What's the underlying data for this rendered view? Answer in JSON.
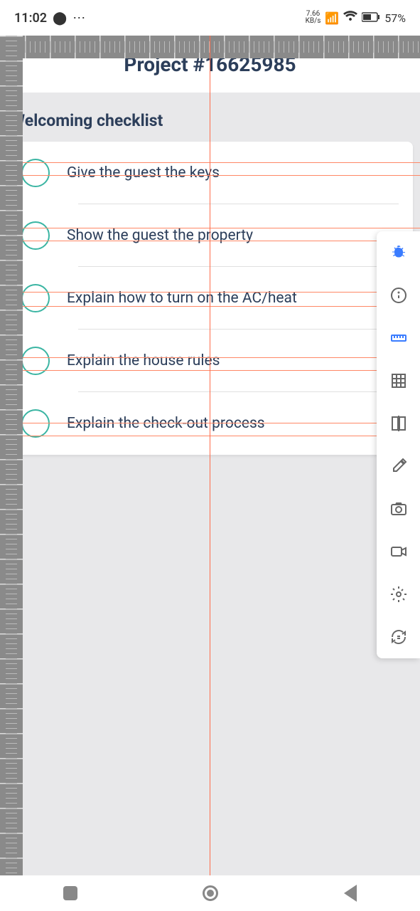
{
  "status": {
    "time": "11:02",
    "kbs_top": "7.66",
    "kbs_bottom": "KB/s",
    "battery_pct": "57%"
  },
  "header": {
    "title": "Project #16625985"
  },
  "section": {
    "title": "Welcoming checklist"
  },
  "checklist": [
    {
      "text": "Give the guest the keys"
    },
    {
      "text": "Show the guest the property"
    },
    {
      "text": "Explain how to turn on the AC/heat"
    },
    {
      "text": "Explain the house rules"
    },
    {
      "text": "Explain the check-out process"
    }
  ],
  "guides_h": [
    228,
    246,
    320,
    338,
    410,
    430,
    502,
    520,
    594,
    612
  ]
}
